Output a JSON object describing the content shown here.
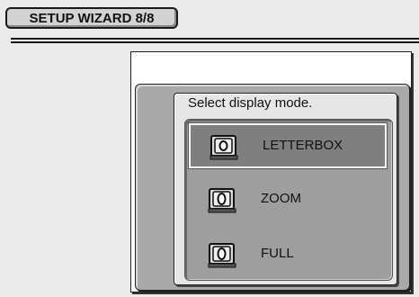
{
  "header": {
    "title": "SETUP WIZARD 8/8"
  },
  "dialog": {
    "prompt": "Select  display mode.",
    "options": [
      {
        "label": "LETTERBOX",
        "icon": "tv-icon",
        "selected": true
      },
      {
        "label": "ZOOM",
        "icon": "tv-icon",
        "selected": false
      },
      {
        "label": "FULL",
        "icon": "tv-icon",
        "selected": false
      }
    ]
  },
  "colors": {
    "background": "#ebebeb",
    "panel_gray": "#a9a9a9",
    "selection": "#7f7f7f"
  }
}
